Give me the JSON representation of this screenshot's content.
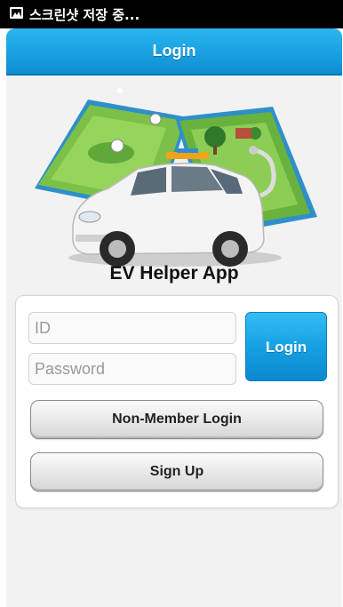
{
  "status_bar": {
    "text": "스크린샷 저장 중...",
    "icon": "image-icon"
  },
  "header": {
    "title": "Login"
  },
  "main": {
    "app_title": "EV Helper App",
    "hero_image": "ev-car-map-illustration",
    "form": {
      "id_placeholder": "ID",
      "password_placeholder": "Password",
      "login_label": "Login",
      "non_member_label": "Non-Member Login",
      "signup_label": "Sign Up"
    }
  },
  "colors": {
    "accent": "#1aa2e2",
    "status_bar": "#000000",
    "background": "#f2f2f2"
  }
}
